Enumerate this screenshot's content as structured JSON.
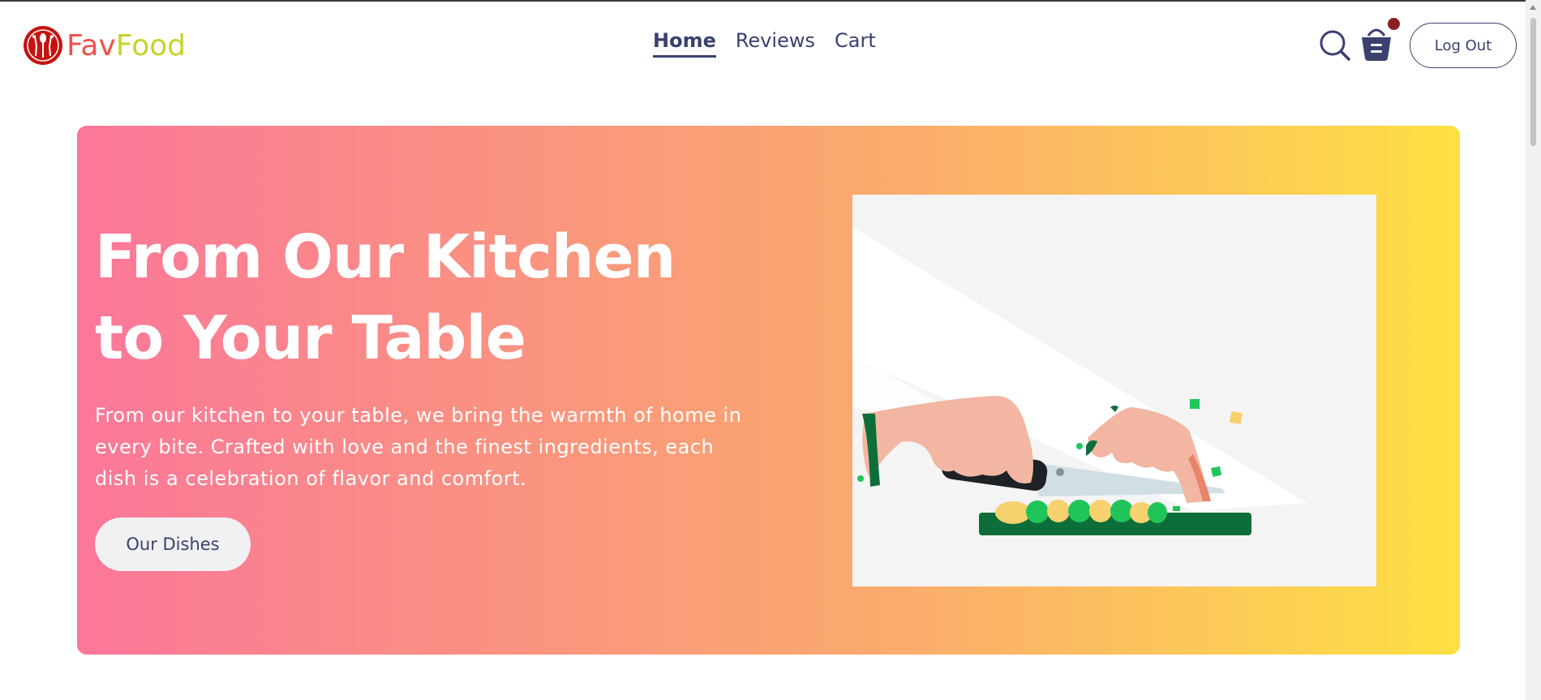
{
  "brand": {
    "name_part1": "Fav",
    "name_part2": "Food",
    "color1": "#f0524a",
    "color2": "#c8d22a",
    "logo_icon": "utensils-logo-icon"
  },
  "nav": {
    "links": [
      {
        "label": "Home",
        "active": true
      },
      {
        "label": "Reviews",
        "active": false
      },
      {
        "label": "Cart",
        "active": false
      }
    ]
  },
  "header_actions": {
    "search_icon": "search-icon",
    "cart_icon": "basket-icon",
    "logout_label": "Log Out"
  },
  "hero": {
    "title": "From Our Kitchen to Your Table",
    "description": "From our kitchen to your table, we bring the warmth of home in every bite. Crafted with love and the finest ingredients, each dish is a celebration of flavor and comfort.",
    "cta_label": "Our Dishes",
    "illustration": "chopping-vegetables-illustration",
    "gradient": [
      "#fb7799",
      "#fa9a7a",
      "#fbac6c",
      "#fdcd55",
      "#fde042"
    ]
  },
  "colors": {
    "text": "#3a4170",
    "notification_dot": "#8b1f1f"
  }
}
